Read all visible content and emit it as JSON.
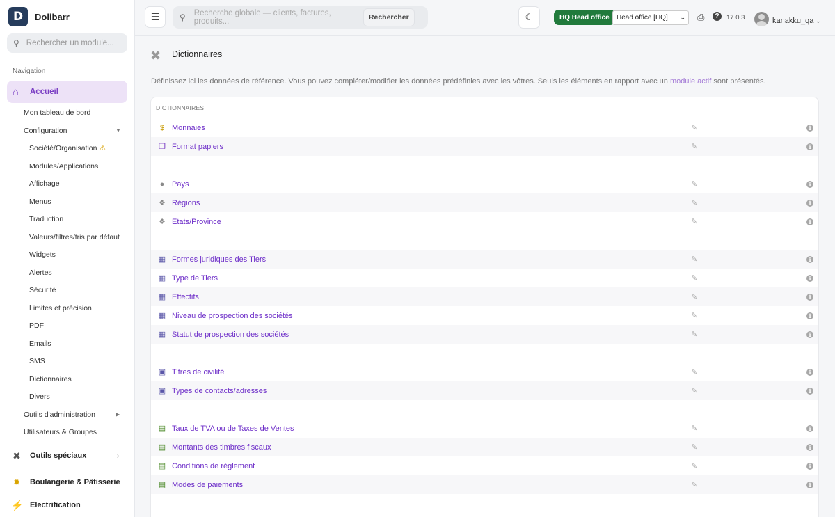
{
  "app": {
    "name": "Dolibarr",
    "logo_letter": "D"
  },
  "sidebar": {
    "search_placeholder": "Rechercher un module...",
    "nav_title": "Navigation",
    "home": {
      "label": "Accueil",
      "icon": "home-icon"
    },
    "sub_items": [
      {
        "label": "Mon tableau de bord",
        "level": 1
      },
      {
        "label": "Configuration",
        "level": 1,
        "expanded": true
      },
      {
        "label": "Société/Organisation",
        "level": 2,
        "warning": true
      },
      {
        "label": "Modules/Applications",
        "level": 2
      },
      {
        "label": "Affichage",
        "level": 2
      },
      {
        "label": "Menus",
        "level": 2
      },
      {
        "label": "Traduction",
        "level": 2
      },
      {
        "label": "Valeurs/filtres/tris par défaut",
        "level": 2
      },
      {
        "label": "Widgets",
        "level": 2
      },
      {
        "label": "Alertes",
        "level": 2
      },
      {
        "label": "Sécurité",
        "level": 2
      },
      {
        "label": "Limites et précision",
        "level": 2
      },
      {
        "label": "PDF",
        "level": 2
      },
      {
        "label": "Emails",
        "level": 2
      },
      {
        "label": "SMS",
        "level": 2
      },
      {
        "label": "Dictionnaires",
        "level": 2
      },
      {
        "label": "Divers",
        "level": 2
      },
      {
        "label": "Outils d'administration",
        "level": 1,
        "collapsed": true
      },
      {
        "label": "Utilisateurs & Groupes",
        "level": 1
      }
    ],
    "modules": [
      {
        "label": "Outils spéciaux",
        "icon": "tools-icon",
        "color": "#555555",
        "has_arrow": true
      },
      {
        "label": "Boulangerie & Pâtisserie",
        "icon": "bread-icon",
        "color": "#d9a400"
      },
      {
        "label": "Electrification",
        "icon": "lightning-icon",
        "color": "#e8b800"
      }
    ]
  },
  "topbar": {
    "search_placeholder": "Recherche globale — clients, factures, produits...",
    "search_button": "Rechercher",
    "entity_badge": "HQ Head office",
    "entity_select": "Head office [HQ]",
    "version": "17.0.3",
    "username": "kanakku_qa"
  },
  "page": {
    "title": "Dictionnaires",
    "intro_before": "Définissez ici les données de référence. Vous pouvez compléter/modifier les données prédéfinies avec les vôtres. Seuls les éléments en rapport avec un",
    "intro_link": "module actif",
    "intro_after": "sont présentés.",
    "table_header": "DICTIONNAIRES",
    "rows": [
      {
        "label": "Monnaies",
        "icon": "dollar-icon",
        "color": "#c79a00"
      },
      {
        "label": "Format papiers",
        "icon": "document-icon",
        "color": "#7b3fc4"
      },
      {
        "label": "Pays",
        "icon": "globe-icon",
        "color": "#8a8a8a"
      },
      {
        "label": "Régions",
        "icon": "region-icon",
        "color": "#8a8a8a"
      },
      {
        "label": "Etats/Province",
        "icon": "region-icon",
        "color": "#8a8a8a"
      },
      {
        "label": "Formes juridiques des Tiers",
        "icon": "building-icon",
        "color": "#5a56a8"
      },
      {
        "label": "Type de Tiers",
        "icon": "building-icon",
        "color": "#5a56a8"
      },
      {
        "label": "Effectifs",
        "icon": "building-icon",
        "color": "#5a56a8"
      },
      {
        "label": "Niveau de prospection des sociétés",
        "icon": "building-icon",
        "color": "#5a56a8"
      },
      {
        "label": "Statut de prospection des sociétés",
        "icon": "building-icon",
        "color": "#5a56a8"
      },
      {
        "label": "Titres de civilité",
        "icon": "contact-card-icon",
        "color": "#5a56a8"
      },
      {
        "label": "Types de contacts/adresses",
        "icon": "contact-card-icon",
        "color": "#5a56a8"
      },
      {
        "label": "Taux de TVA ou de Taxes de Ventes",
        "icon": "invoice-icon",
        "color": "#4d8a2a"
      },
      {
        "label": "Montants des timbres fiscaux",
        "icon": "invoice-icon",
        "color": "#4d8a2a"
      },
      {
        "label": "Conditions de règlement",
        "icon": "invoice-icon",
        "color": "#4d8a2a"
      },
      {
        "label": "Modes de paiements",
        "icon": "invoice-icon",
        "color": "#4d8a2a"
      }
    ]
  }
}
